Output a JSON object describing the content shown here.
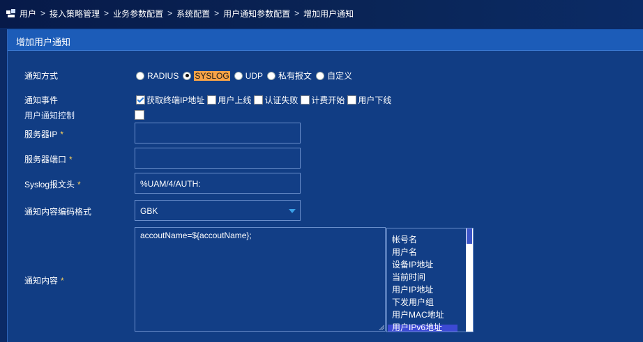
{
  "breadcrumb": [
    "用户",
    "接入策略管理",
    "业务参数配置",
    "系统配置",
    "用户通知参数配置",
    "增加用户通知"
  ],
  "breadcrumb_sep": ">",
  "panel": {
    "title": "增加用户通知"
  },
  "notify_method": {
    "label": "通知方式",
    "options": [
      "RADIUS",
      "SYSLOG",
      "UDP",
      "私有报文",
      "自定义"
    ],
    "selected": "SYSLOG"
  },
  "notify_events": {
    "label": "通知事件",
    "options": [
      {
        "label": "获取终端IP地址",
        "checked": true
      },
      {
        "label": "用户上线",
        "checked": false
      },
      {
        "label": "认证失败",
        "checked": false
      },
      {
        "label": "计费开始",
        "checked": false
      },
      {
        "label": "用户下线",
        "checked": false
      }
    ]
  },
  "user_notify_control": {
    "label": "用户通知控制",
    "checked": false
  },
  "server_ip": {
    "label": "服务器IP",
    "required_mark": "*",
    "value": ""
  },
  "server_port": {
    "label": "服务器端口",
    "required_mark": "*",
    "value": ""
  },
  "syslog_header": {
    "label": "Syslog报文头",
    "required_mark": "*",
    "value": "%UAM/4/AUTH:"
  },
  "encoding": {
    "label": "通知内容编码格式",
    "value": "GBK"
  },
  "content": {
    "label": "通知内容",
    "required_mark": "*",
    "value": "accoutName=${accoutName};",
    "variables": [
      "帐号名",
      "用户名",
      "设备IP地址",
      "当前时间",
      "用户IP地址",
      "下发用户组",
      "用户MAC地址",
      "用户IPv6地址"
    ]
  },
  "colors": {
    "accent": "#1c5cb8",
    "panel_bg": "#113d84",
    "selected_highlight": "#f7a348",
    "required": "#ffd45a"
  }
}
